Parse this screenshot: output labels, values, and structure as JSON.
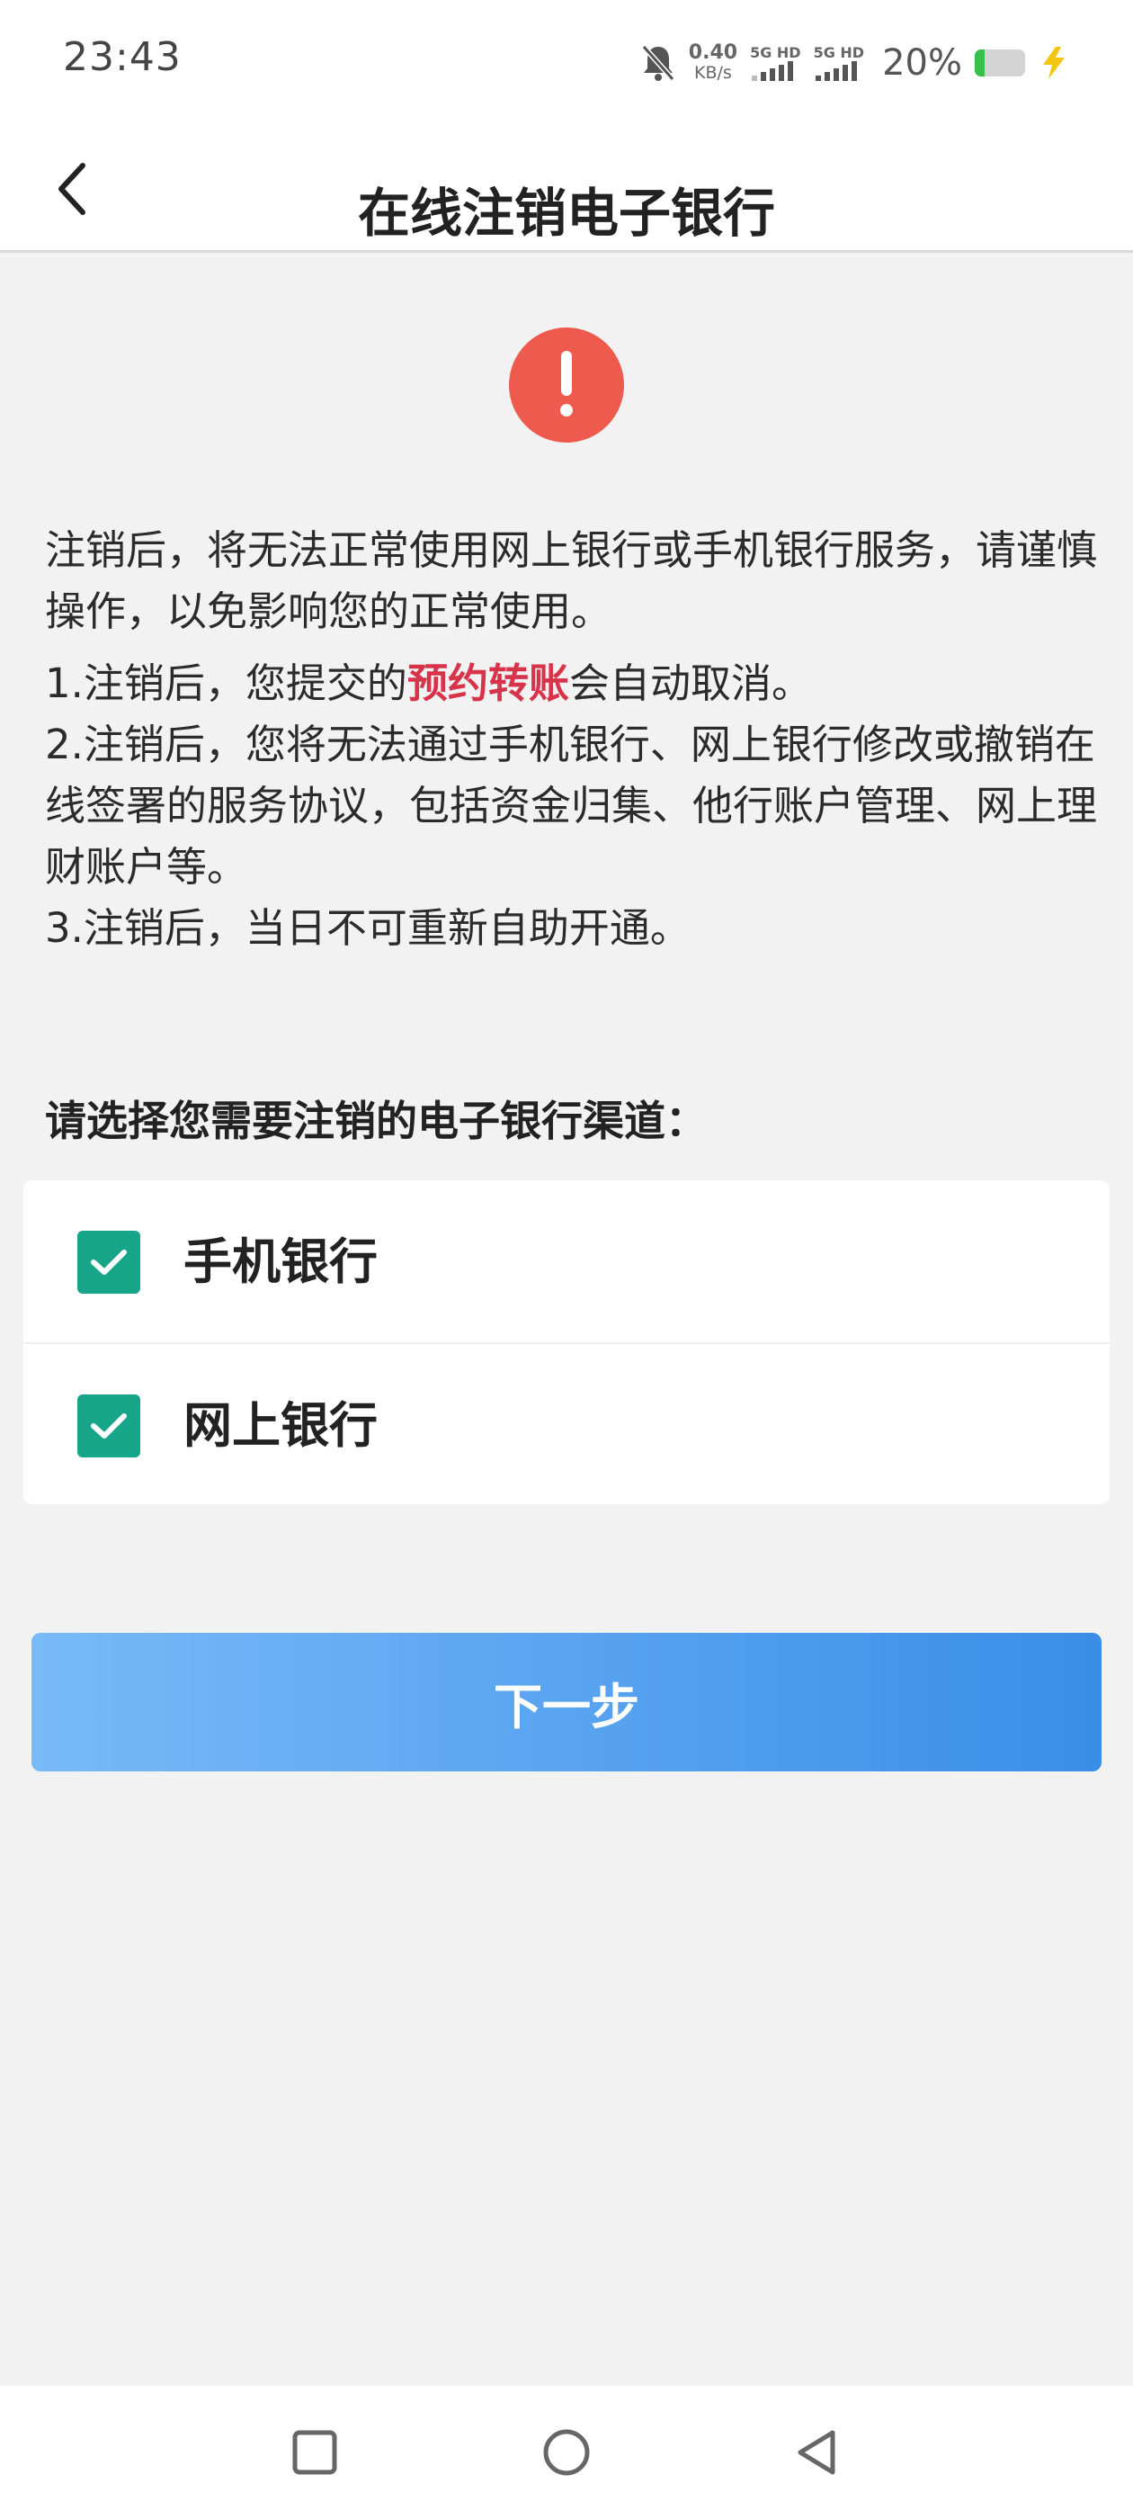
{
  "status_bar": {
    "time": "23:43",
    "net_speed_value": "0.40",
    "net_speed_unit": "KB/s",
    "sim1_label": "5G HD",
    "sim2_label": "5G HD",
    "battery_percent_text": "20%",
    "battery_level": 0.2,
    "battery_color": "#33c14a",
    "icons": [
      "bell-mute-icon",
      "signal-icon",
      "battery-icon",
      "charging-bolt-icon"
    ]
  },
  "nav": {
    "back_icon": "chevron-left-icon",
    "title": "在线注销电子银行"
  },
  "warning_icon": "exclamation-icon",
  "notice": {
    "intro": "注销后，将无法正常使用网上银行或手机银行服务，请谨慎操作，以免影响您的正常使用。",
    "item1_pre": "1.注销后，您提交的",
    "item1_highlight": "预约转账",
    "item1_post": "会自动取消。",
    "item2": "2.注销后，您将无法通过手机银行、网上银行修改或撤销在线签署的服务协议，包括资金归集、他行账户管理、网上理财账户等。",
    "item3": "3.注销后，当日不可重新自助开通。",
    "highlight_color": "#d7334a"
  },
  "channel_select": {
    "prompt": "请选择您需要注销的电子银行渠道：",
    "options": [
      {
        "label": "手机银行",
        "checked": true
      },
      {
        "label": "网上银行",
        "checked": true
      }
    ],
    "checkbox_color": "#17a589"
  },
  "next_button": {
    "label": "下一步",
    "gradient": [
      "#78baf8",
      "#3a8ee8"
    ]
  },
  "system_nav": {
    "icons": [
      "recent-apps-icon",
      "home-icon",
      "back-triangle-icon"
    ]
  }
}
